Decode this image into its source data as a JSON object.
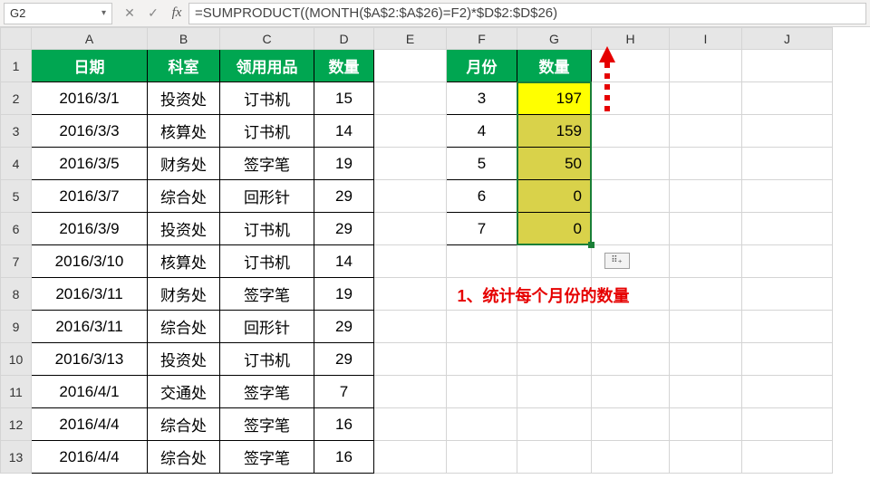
{
  "namebox": {
    "value": "G2"
  },
  "formula": "=SUMPRODUCT((MONTH($A$2:$A$26)=F2)*$D$2:$D$26)",
  "columns": [
    "A",
    "B",
    "C",
    "D",
    "E",
    "F",
    "G",
    "H",
    "I",
    "J"
  ],
  "headers": {
    "A": "日期",
    "B": "科室",
    "C": "领用用品",
    "D": "数量"
  },
  "summary_headers": {
    "F": "月份",
    "G": "数量"
  },
  "rows": [
    {
      "A": "2016/3/1",
      "B": "投资处",
      "C": "订书机",
      "D": "15"
    },
    {
      "A": "2016/3/3",
      "B": "核算处",
      "C": "订书机",
      "D": "14"
    },
    {
      "A": "2016/3/5",
      "B": "财务处",
      "C": "签字笔",
      "D": "19"
    },
    {
      "A": "2016/3/7",
      "B": "综合处",
      "C": "回形针",
      "D": "29"
    },
    {
      "A": "2016/3/9",
      "B": "投资处",
      "C": "订书机",
      "D": "29"
    },
    {
      "A": "2016/3/10",
      "B": "核算处",
      "C": "订书机",
      "D": "14"
    },
    {
      "A": "2016/3/11",
      "B": "财务处",
      "C": "签字笔",
      "D": "19"
    },
    {
      "A": "2016/3/11",
      "B": "综合处",
      "C": "回形针",
      "D": "29"
    },
    {
      "A": "2016/3/13",
      "B": "投资处",
      "C": "订书机",
      "D": "29"
    },
    {
      "A": "2016/4/1",
      "B": "交通处",
      "C": "签字笔",
      "D": "7"
    },
    {
      "A": "2016/4/4",
      "B": "综合处",
      "C": "签字笔",
      "D": "16"
    },
    {
      "A": "2016/4/4",
      "B": "综合处",
      "C": "签字笔",
      "D": "16"
    }
  ],
  "summary": [
    {
      "F": "3",
      "G": "197",
      "hl": "yellow"
    },
    {
      "F": "4",
      "G": "159",
      "hl": "olive"
    },
    {
      "F": "5",
      "G": "50",
      "hl": "olive"
    },
    {
      "F": "6",
      "G": "0",
      "hl": "olive"
    },
    {
      "F": "7",
      "G": "0",
      "hl": "olive"
    }
  ],
  "annotation": "1、统计每个月份的数量",
  "autofill_glyph": "⠿₊"
}
